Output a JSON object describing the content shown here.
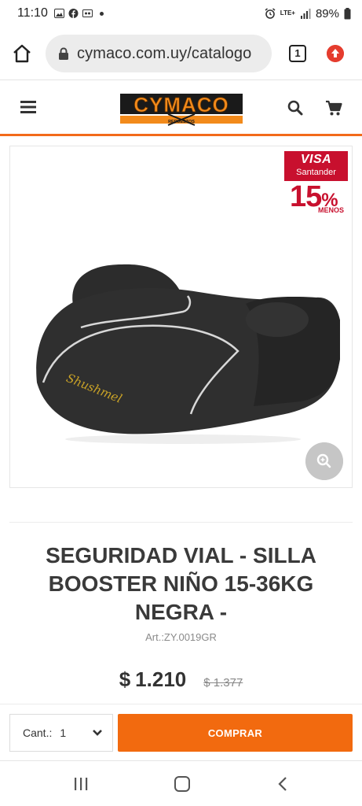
{
  "status_bar": {
    "time": "11:10",
    "battery": "89%",
    "network": "LTE+"
  },
  "browser": {
    "url": "cymaco.com.uy/catalogo",
    "tab_count": "1"
  },
  "site": {
    "logo_text": "CYMACO",
    "logo_subtext": "REPUESTOS"
  },
  "promo": {
    "brand": "VISA",
    "bank": "Santander",
    "discount": "15",
    "percent_sign": "%",
    "label": "MENOS"
  },
  "product": {
    "title": "SEGURIDAD VIAL - SILLA BOOSTER NIÑO 15-36KG NEGRA -",
    "sku": "Art.:ZY.0019GR",
    "currency": "$",
    "price": "1.210",
    "old_price": "$ 1.377",
    "seat_brand_print": "Shushmel"
  },
  "purchase": {
    "qty_label": "Cant.:",
    "qty_value": "1",
    "buy_label": "COMPRAR"
  },
  "colors": {
    "accent": "#f26a0f",
    "promo_red": "#c8102e"
  }
}
